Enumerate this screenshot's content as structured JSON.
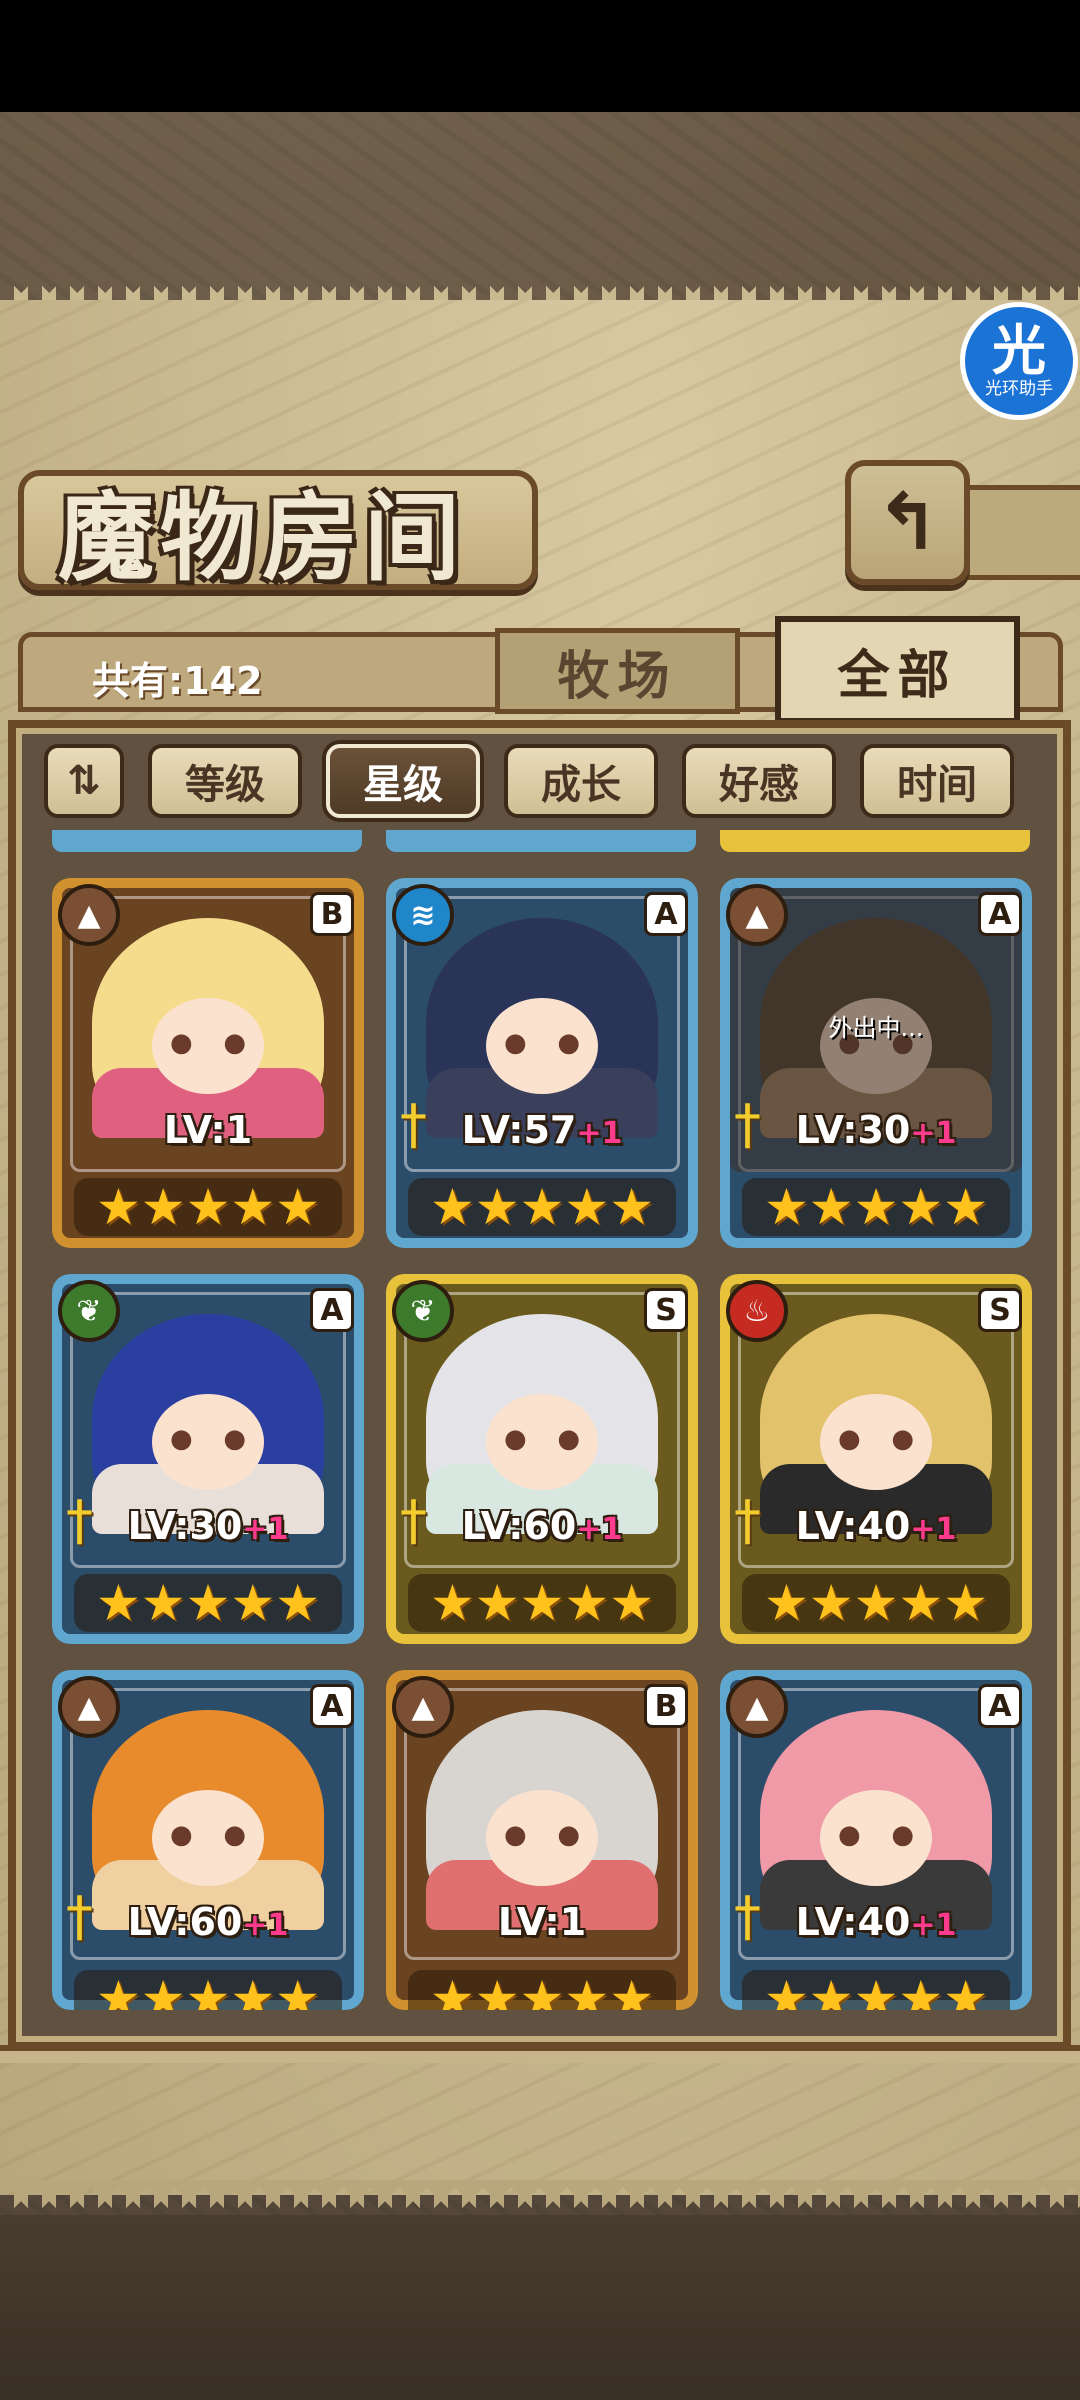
{
  "header": {
    "title": "魔物房间",
    "back_icon": "return-arrow-icon",
    "app_badge": {
      "big": "光",
      "small": "光环助手"
    }
  },
  "tabs": {
    "total_label": "共有:142",
    "pasture": "牧场",
    "all": "全部",
    "active": "all"
  },
  "sort": {
    "toggle_icon": "sort-direction-icon",
    "toggle_glyph": "⇅",
    "buttons": [
      {
        "label": "等级",
        "active": false
      },
      {
        "label": "星级",
        "active": true
      },
      {
        "label": "成长",
        "active": false
      },
      {
        "label": "好感",
        "active": false
      },
      {
        "label": "时间",
        "active": false
      }
    ]
  },
  "cards": [
    {
      "frame": "gold",
      "element": "earth",
      "element_glyph": "▲",
      "rank": "B",
      "level_text": "LV:1",
      "plus": "",
      "stars": "★★★★★",
      "status": "",
      "colors": {
        "hair": "#f5dc8c",
        "outfit": "#e06080"
      }
    },
    {
      "frame": "blue",
      "element": "water",
      "element_glyph": "≋",
      "rank": "A",
      "level_text": "LV:57",
      "plus": "+1",
      "stars": "★★★★★",
      "status": "",
      "colors": {
        "hair": "#2a3458",
        "outfit": "#3a3f5c"
      }
    },
    {
      "frame": "blue",
      "element": "earth",
      "element_glyph": "▲",
      "rank": "A",
      "level_text": "LV:30",
      "plus": "+1",
      "stars": "★★★★★",
      "status": "外出中...",
      "colors": {
        "hair": "#4a3a2a",
        "outfit": "#a08060"
      }
    },
    {
      "frame": "blue",
      "element": "leaf",
      "element_glyph": "❦",
      "rank": "A",
      "level_text": "LV:30",
      "plus": "+1",
      "stars": "★★★★★",
      "status": "",
      "colors": {
        "hair": "#2b3fa0",
        "outfit": "#e8e0d8"
      }
    },
    {
      "frame": "yellow",
      "element": "leaf",
      "element_glyph": "❦",
      "rank": "S",
      "level_text": "LV:60",
      "plus": "+1",
      "stars": "★★★★★",
      "status": "",
      "colors": {
        "hair": "#e4e4e8",
        "outfit": "#d8e8e0"
      }
    },
    {
      "frame": "yellow",
      "element": "fire",
      "element_glyph": "♨",
      "rank": "S",
      "level_text": "LV:40",
      "plus": "+1",
      "stars": "★★★★★",
      "status": "",
      "colors": {
        "hair": "#e2c26a",
        "outfit": "#2a2a2a"
      }
    },
    {
      "frame": "blue",
      "element": "earth",
      "element_glyph": "▲",
      "rank": "A",
      "level_text": "LV:60",
      "plus": "+1",
      "stars": "★★★★★",
      "status": "",
      "colors": {
        "hair": "#e88b2c",
        "outfit": "#f0d0a0"
      }
    },
    {
      "frame": "gold",
      "element": "earth",
      "element_glyph": "▲",
      "rank": "B",
      "level_text": "LV:1",
      "plus": "",
      "stars": "★★★★★",
      "status": "",
      "colors": {
        "hair": "#d8d4d0",
        "outfit": "#e07070"
      }
    },
    {
      "frame": "blue",
      "element": "earth",
      "element_glyph": "▲",
      "rank": "A",
      "level_text": "LV:40",
      "plus": "+1",
      "stars": "★★★★★",
      "status": "",
      "colors": {
        "hair": "#f09aa8",
        "outfit": "#3a3a3a"
      }
    }
  ],
  "sword_glyph": "†"
}
